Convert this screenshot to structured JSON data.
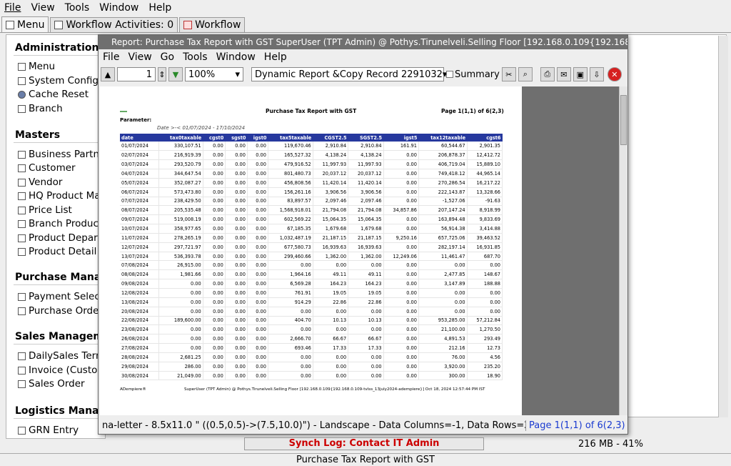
{
  "app_menu": [
    "File",
    "View",
    "Tools",
    "Window",
    "Help"
  ],
  "tabs": [
    {
      "label": "Menu",
      "icon": "home-icon"
    },
    {
      "label": "Workflow Activities: 0",
      "icon": "table-icon"
    },
    {
      "label": "Workflow",
      "icon": "workflow-icon"
    }
  ],
  "sidebar": {
    "sections": [
      {
        "title": "Administration",
        "items": [
          "Menu",
          "System Configu",
          "Cache Reset",
          "Branch"
        ]
      },
      {
        "title": "Masters",
        "items": [
          "Business Partne",
          "Customer",
          "Vendor",
          "HQ Product Mas",
          "Price List",
          "Branch Product",
          "Product Departr",
          "Product Detail"
        ]
      },
      {
        "title": "Purchase Manag",
        "items": [
          "Payment Select",
          "Purchase Order"
        ]
      },
      {
        "title": "Sales Manageme",
        "items": [
          "DailySales Term",
          "Invoice (Custon",
          "Sales Order"
        ]
      },
      {
        "title": "Logistics Manag",
        "items": [
          "GRN Entry"
        ]
      }
    ]
  },
  "window": {
    "title": "Report: Purchase Tax Report with GST  SuperUser (TPT Admin) @ Pothys.Tirunelveli.Selling Floor [192.168.0.109{192.168.0.109",
    "menu": [
      "File",
      "View",
      "Go",
      "Tools",
      "Window",
      "Help"
    ],
    "toolbar": {
      "page": "1",
      "zoom": "100%",
      "report_format": "Dynamic Report &Copy Record 2291032",
      "summary_label": "Summary"
    },
    "status_left": "na-letter - 8.5x11.0 \" ((0.5,0.5)->(7.5,10.0)\") - Landscape - Data Columns=-1, Data Rows=29",
    "status_right": "Page 1(1,1) of 6(2,3)"
  },
  "report": {
    "title": "Purchase Tax Report with GST",
    "page": "Page 1(1,1) of 6(2,3)",
    "parameter_label": "Parameter:",
    "parameter_value": "Date  >-<  01/07/2024 - 17/10/2024",
    "columns": [
      "date",
      "tax0taxable",
      "cgst0",
      "sgst0",
      "igst0",
      "tax5taxable",
      "CGST2.5",
      "SGST2.5",
      "igst5",
      "tax12taxable",
      "cgst6"
    ],
    "rows": [
      [
        "01/07/2024",
        "330,107.51",
        "0.00",
        "0.00",
        "0.00",
        "119,670.46",
        "2,910.84",
        "2,910.84",
        "161.91",
        "60,544.67",
        "2,901.35"
      ],
      [
        "02/07/2024",
        "216,919.39",
        "0.00",
        "0.00",
        "0.00",
        "165,527.32",
        "4,138.24",
        "4,138.24",
        "0.00",
        "206,878.37",
        "12,412.72"
      ],
      [
        "03/07/2024",
        "293,520.79",
        "0.00",
        "0.00",
        "0.00",
        "479,916.52",
        "11,997.93",
        "11,997.93",
        "0.00",
        "406,719.04",
        "15,889.10"
      ],
      [
        "04/07/2024",
        "344,647.54",
        "0.00",
        "0.00",
        "0.00",
        "801,480.73",
        "20,037.12",
        "20,037.12",
        "0.00",
        "749,418.12",
        "44,965.14"
      ],
      [
        "05/07/2024",
        "352,087.27",
        "0.00",
        "0.00",
        "0.00",
        "456,808.56",
        "11,420.14",
        "11,420.14",
        "0.00",
        "270,286.54",
        "16,217.22"
      ],
      [
        "06/07/2024",
        "573,473.80",
        "0.00",
        "0.00",
        "0.00",
        "156,261.16",
        "3,906.56",
        "3,906.56",
        "0.00",
        "222,143.87",
        "13,328.66"
      ],
      [
        "07/07/2024",
        "238,429.50",
        "0.00",
        "0.00",
        "0.00",
        "83,897.57",
        "2,097.46",
        "2,097.46",
        "0.00",
        "-1,527.06",
        "-91.63"
      ],
      [
        "08/07/2024",
        "205,535.48",
        "0.00",
        "0.00",
        "0.00",
        "1,568,918.01",
        "21,794.08",
        "21,794.08",
        "34,857.86",
        "207,147.24",
        "8,918.99"
      ],
      [
        "09/07/2024",
        "519,008.19",
        "0.00",
        "0.00",
        "0.00",
        "602,569.22",
        "15,064.35",
        "15,064.35",
        "0.00",
        "163,894.48",
        "9,833.69"
      ],
      [
        "10/07/2024",
        "358,977.65",
        "0.00",
        "0.00",
        "0.00",
        "67,185.35",
        "1,679.68",
        "1,679.68",
        "0.00",
        "56,914.38",
        "3,414.88"
      ],
      [
        "11/07/2024",
        "278,265.19",
        "0.00",
        "0.00",
        "0.00",
        "1,032,487.19",
        "21,187.15",
        "21,187.15",
        "9,250.16",
        "657,725.06",
        "39,463.52"
      ],
      [
        "12/07/2024",
        "297,721.97",
        "0.00",
        "0.00",
        "0.00",
        "677,580.73",
        "16,939.63",
        "16,939.63",
        "0.00",
        "282,197.14",
        "16,931.85"
      ],
      [
        "13/07/2024",
        "536,393.78",
        "0.00",
        "0.00",
        "0.00",
        "299,460.66",
        "1,362.00",
        "1,362.00",
        "12,249.06",
        "11,461.47",
        "687.70"
      ],
      [
        "07/08/2024",
        "26,915.00",
        "0.00",
        "0.00",
        "0.00",
        "0.00",
        "0.00",
        "0.00",
        "0.00",
        "0.00",
        "0.00"
      ],
      [
        "08/08/2024",
        "1,981.66",
        "0.00",
        "0.00",
        "0.00",
        "1,964.16",
        "49.11",
        "49.11",
        "0.00",
        "2,477.85",
        "148.67"
      ],
      [
        "09/08/2024",
        "0.00",
        "0.00",
        "0.00",
        "0.00",
        "6,569.28",
        "164.23",
        "164.23",
        "0.00",
        "3,147.89",
        "188.88"
      ],
      [
        "12/08/2024",
        "0.00",
        "0.00",
        "0.00",
        "0.00",
        "761.91",
        "19.05",
        "19.05",
        "0.00",
        "0.00",
        "0.00"
      ],
      [
        "13/08/2024",
        "0.00",
        "0.00",
        "0.00",
        "0.00",
        "914.29",
        "22.86",
        "22.86",
        "0.00",
        "0.00",
        "0.00"
      ],
      [
        "20/08/2024",
        "0.00",
        "0.00",
        "0.00",
        "0.00",
        "0.00",
        "0.00",
        "0.00",
        "0.00",
        "0.00",
        "0.00"
      ],
      [
        "22/08/2024",
        "189,600.00",
        "0.00",
        "0.00",
        "0.00",
        "404.70",
        "10.13",
        "10.13",
        "0.00",
        "953,285.00",
        "57,212.84"
      ],
      [
        "23/08/2024",
        "0.00",
        "0.00",
        "0.00",
        "0.00",
        "0.00",
        "0.00",
        "0.00",
        "0.00",
        "21,100.00",
        "1,270.50"
      ],
      [
        "26/08/2024",
        "0.00",
        "0.00",
        "0.00",
        "0.00",
        "2,666.70",
        "66.67",
        "66.67",
        "0.00",
        "4,891.53",
        "293.49"
      ],
      [
        "27/08/2024",
        "0.00",
        "0.00",
        "0.00",
        "0.00",
        "693.46",
        "17.33",
        "17.33",
        "0.00",
        "212.16",
        "12.73"
      ],
      [
        "28/08/2024",
        "2,681.25",
        "0.00",
        "0.00",
        "0.00",
        "0.00",
        "0.00",
        "0.00",
        "0.00",
        "76.00",
        "4.56"
      ],
      [
        "29/08/2024",
        "286.00",
        "0.00",
        "0.00",
        "0.00",
        "0.00",
        "0.00",
        "0.00",
        "0.00",
        "3,920.00",
        "235.20"
      ],
      [
        "30/08/2024",
        "21,049.00",
        "0.00",
        "0.00",
        "0.00",
        "0.00",
        "0.00",
        "0.00",
        "0.00",
        "300.00",
        "18.90"
      ]
    ],
    "footer_left": "ADempiere®",
    "footer_right": "SuperUser (TPT Admin) @ Pothys.Tirunelveli.Selling Floor [192.168.0.109{192.168.0.109-tvlss_13july2024-adempiere}] Oct 18, 2024 12:57:44 PM IST"
  },
  "status": {
    "synch": "Synch Log: Contact IT Admin",
    "memory": "216 MB - 41%",
    "bottom_title": "Purchase Tax Report with GST"
  }
}
